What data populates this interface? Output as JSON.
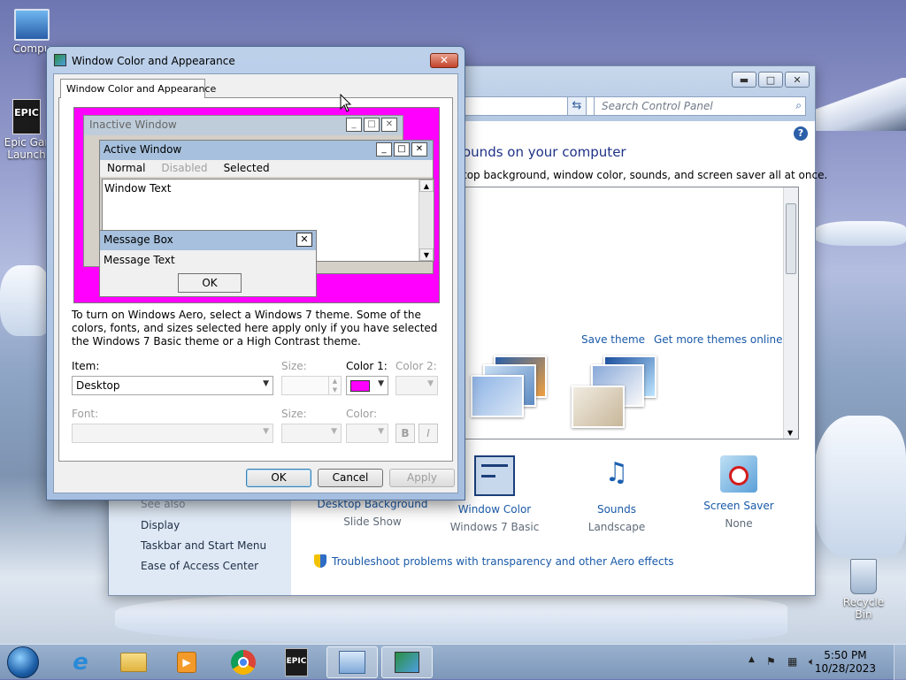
{
  "desktop": {
    "icons": [
      {
        "label": "Compu",
        "icon": "computer-icon"
      },
      {
        "label": "Epic Gar Launch",
        "icon": "epic-games-icon"
      },
      {
        "label": "Recycle Bin",
        "icon": "recycle-bin-icon"
      }
    ]
  },
  "control_panel": {
    "search_placeholder": "Search Control Panel",
    "heading": "ounds on your computer",
    "subheading": "top background, window color, sounds, and screen saver all at once.",
    "save_theme": "Save theme",
    "more_themes": "Get more themes online",
    "see_also": "See also",
    "left_links": [
      "Display",
      "Taskbar and Start Menu",
      "Ease of Access Center"
    ],
    "bottom_items": [
      {
        "title": "Desktop Background",
        "subtitle": "Slide Show",
        "icon": "desktop-background-icon"
      },
      {
        "title": "Window Color",
        "subtitle": "Windows 7 Basic",
        "icon": "window-color-icon"
      },
      {
        "title": "Sounds",
        "subtitle": "Landscape",
        "icon": "sounds-icon"
      },
      {
        "title": "Screen Saver",
        "subtitle": "None",
        "icon": "screen-saver-icon"
      }
    ],
    "troubleshoot": "Troubleshoot problems with transparency and other Aero effects"
  },
  "dialog": {
    "title": "Window Color and Appearance",
    "tab_label": "Window Color and Appearance",
    "preview": {
      "inactive_title": "Inactive Window",
      "active_title": "Active Window",
      "menu": {
        "normal": "Normal",
        "disabled": "Disabled",
        "selected": "Selected"
      },
      "window_text": "Window Text",
      "msgbox_title": "Message Box",
      "msgbox_text": "Message Text",
      "msgbox_ok": "OK"
    },
    "description": "To turn on Windows Aero, select a Windows 7 theme.  Some of the colors, fonts, and sizes selected here apply only if you have selected the Windows 7 Basic theme or a High Contrast theme.",
    "labels": {
      "item": "Item:",
      "size": "Size:",
      "color1": "Color 1:",
      "color2": "Color 2:",
      "font": "Font:",
      "size2": "Size:",
      "color": "Color:",
      "bold": "B",
      "italic": "I"
    },
    "item_value": "Desktop",
    "color1_value": "#ff00ff",
    "buttons": {
      "ok": "OK",
      "cancel": "Cancel",
      "apply": "Apply"
    }
  },
  "taskbar": {
    "pinned": [
      "internet-explorer-icon",
      "file-explorer-icon",
      "media-player-icon",
      "chrome-icon",
      "epic-games-icon",
      "control-panel-icon",
      "window-color-icon"
    ],
    "time": "5:50 PM",
    "date": "10/28/2023"
  },
  "colors": {
    "accent": "#1a5aa8",
    "preview_bg": "#ff00ff",
    "heading": "#1e3287"
  }
}
